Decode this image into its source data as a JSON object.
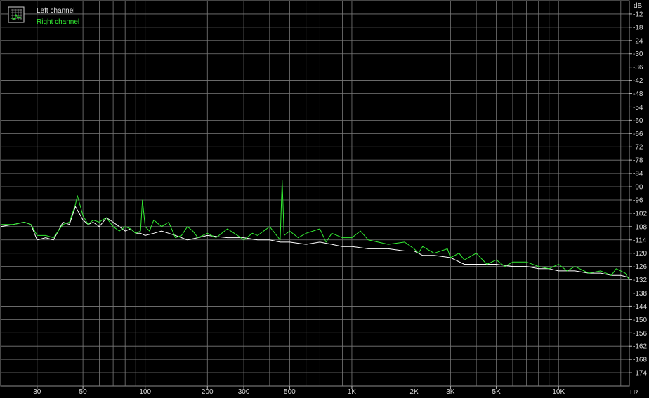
{
  "chart_data": {
    "type": "line",
    "xscale": "log",
    "xlim": [
      20,
      22000
    ],
    "ylim": [
      -180,
      -6
    ],
    "xunit": "Hz",
    "yunit": "dB",
    "grid": true,
    "legend_placement": "top-left",
    "x_ticks": [
      {
        "value": 30,
        "label": "30"
      },
      {
        "value": 50,
        "label": "50"
      },
      {
        "value": 100,
        "label": "100"
      },
      {
        "value": 200,
        "label": "200"
      },
      {
        "value": 300,
        "label": "300"
      },
      {
        "value": 500,
        "label": "500"
      },
      {
        "value": 1000,
        "label": "1K"
      },
      {
        "value": 2000,
        "label": "2K"
      },
      {
        "value": 3000,
        "label": "3K"
      },
      {
        "value": 5000,
        "label": "5K"
      },
      {
        "value": 10000,
        "label": "10K"
      }
    ],
    "x_minor_grid": [
      20,
      40,
      60,
      70,
      80,
      90,
      400,
      600,
      700,
      800,
      900,
      4000,
      6000,
      7000,
      8000,
      9000,
      20000
    ],
    "y_ticks": [
      -12,
      -18,
      -24,
      -30,
      -36,
      -42,
      -48,
      -54,
      -60,
      -66,
      -72,
      -78,
      -84,
      -90,
      -96,
      -102,
      -108,
      -114,
      -120,
      -126,
      -132,
      -138,
      -144,
      -150,
      -156,
      -162,
      -168,
      -174
    ],
    "series": [
      {
        "name": "Left channel",
        "color": "#ffffff",
        "x": [
          20,
          23,
          26,
          28,
          30,
          33,
          36,
          40,
          43,
          46,
          50,
          53,
          56,
          60,
          65,
          70,
          75,
          80,
          85,
          90,
          95,
          100,
          110,
          120,
          130,
          140,
          150,
          160,
          180,
          200,
          250,
          300,
          350,
          400,
          450,
          500,
          600,
          700,
          800,
          900,
          1000,
          1200,
          1500,
          1800,
          2000,
          2200,
          2500,
          3000,
          3500,
          4000,
          5000,
          6000,
          7000,
          8000,
          9000,
          10000,
          12000,
          14000,
          16000,
          18000,
          20000,
          22000
        ],
        "y": [
          -108,
          -107,
          -106,
          -107,
          -114,
          -113,
          -114,
          -106,
          -107,
          -99,
          -105,
          -107,
          -106,
          -108,
          -104,
          -106,
          -108,
          -110,
          -109,
          -111,
          -111,
          -112,
          -111,
          -110,
          -111,
          -112,
          -113,
          -114,
          -113,
          -112,
          -113,
          -113,
          -114,
          -114,
          -115,
          -115,
          -116,
          -115,
          -116,
          -117,
          -117,
          -118,
          -118,
          -119,
          -119,
          -121,
          -121,
          -122,
          -125,
          -125,
          -125,
          -126,
          -126,
          -127,
          -127,
          -128,
          -128,
          -129,
          -129,
          -130,
          -130,
          -131
        ]
      },
      {
        "name": "Right channel",
        "color": "#33ee33",
        "x": [
          20,
          23,
          26,
          28,
          30,
          33,
          36,
          40,
          43,
          46,
          47,
          50,
          53,
          56,
          60,
          62,
          65,
          70,
          75,
          80,
          85,
          90,
          95,
          97,
          100,
          105,
          110,
          120,
          130,
          140,
          150,
          160,
          170,
          180,
          200,
          220,
          250,
          280,
          300,
          330,
          350,
          400,
          450,
          460,
          470,
          500,
          550,
          600,
          700,
          750,
          800,
          900,
          1000,
          1100,
          1200,
          1500,
          1800,
          2000,
          2100,
          2200,
          2500,
          2900,
          3000,
          3300,
          3500,
          4000,
          4500,
          5000,
          5500,
          6000,
          7000,
          8000,
          9000,
          10000,
          11000,
          12000,
          14000,
          16000,
          18000,
          19000,
          20000,
          21000,
          22000
        ],
        "y": [
          -107,
          -107,
          -106,
          -107,
          -112,
          -112,
          -113,
          -107,
          -106,
          -98,
          -94,
          -103,
          -107,
          -105,
          -106,
          -105,
          -104,
          -108,
          -110,
          -108,
          -109,
          -111,
          -110,
          -96,
          -108,
          -110,
          -105,
          -108,
          -106,
          -113,
          -112,
          -108,
          -110,
          -113,
          -111,
          -113,
          -109,
          -112,
          -114,
          -111,
          -112,
          -108,
          -114,
          -87,
          -112,
          -110,
          -113,
          -111,
          -109,
          -115,
          -111,
          -113,
          -113,
          -110,
          -114,
          -116,
          -115,
          -118,
          -120,
          -117,
          -120,
          -118,
          -122,
          -120,
          -123,
          -120,
          -125,
          -123,
          -126,
          -124,
          -124,
          -126,
          -127,
          -125,
          -128,
          -126,
          -129,
          -128,
          -130,
          -127,
          -128,
          -129,
          -132
        ]
      }
    ]
  }
}
